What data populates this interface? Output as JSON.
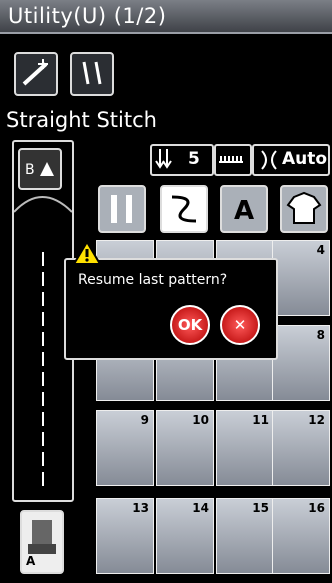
{
  "window": {
    "title": "Utility(U) (1/2)"
  },
  "stitch": {
    "name": "Straight Stitch"
  },
  "settings": {
    "feed_value": "5",
    "tension_label": "Auto"
  },
  "dialog": {
    "message": "Resume last pattern?",
    "ok": "OK",
    "cancel": "✕"
  },
  "grid": {
    "numbers": [
      "4",
      "8",
      "9",
      "10",
      "11",
      "12",
      "13",
      "14",
      "15",
      "16"
    ]
  },
  "foot": {
    "label": "A"
  }
}
